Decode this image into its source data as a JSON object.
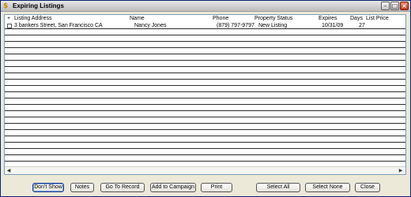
{
  "window": {
    "title": "Expiring Listings",
    "icon": "dollar-icon",
    "icon_glyph": "$",
    "minimize_glyph": "–",
    "maximize_glyph": "□",
    "close_glyph": "×"
  },
  "table": {
    "columns": {
      "check": "+",
      "address": "Listing Address",
      "name": "Name",
      "phone": "Phone",
      "status": "Property Status",
      "expires": "Expires",
      "days": "Days",
      "price": "List Price"
    },
    "rows": [
      {
        "address": "3 bankers Street, San Francisco CA",
        "name": "Nancy Jones",
        "phone": "(879) 797-9797",
        "status": "New Listing",
        "expires": "10/31/09",
        "days": "27",
        "price": ""
      }
    ],
    "scroll_left_glyph": "◀",
    "scroll_right_glyph": "▶"
  },
  "buttons": {
    "dont_show": "Don't Show",
    "notes": "Notes",
    "go_to_record": "Go To Record",
    "add_to_campaign": "Add to Campaign",
    "print": "Print",
    "select_all": "Select All",
    "select_none": "Select None",
    "close": "Close"
  },
  "colors": {
    "list_border": "#7f9db9",
    "row_line": "#2b2b2b",
    "window_bg": "#ece9d8"
  }
}
